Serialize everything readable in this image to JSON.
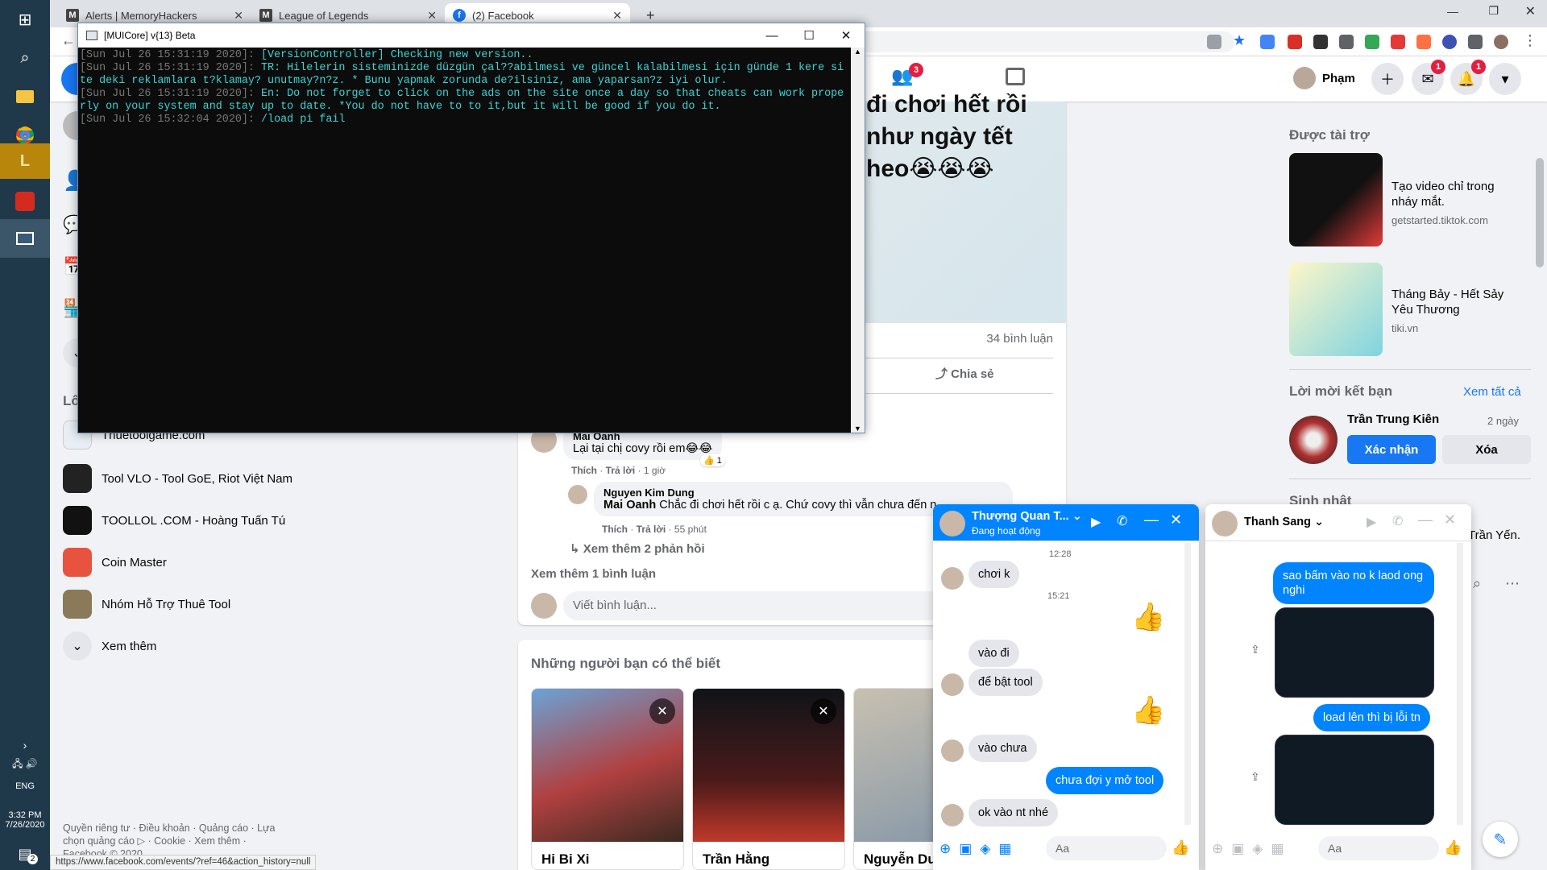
{
  "tabs": [
    {
      "label": "Alerts | MemoryHackers",
      "fav": "M"
    },
    {
      "label": "League of Legends",
      "fav": "M"
    },
    {
      "label": "(2) Facebook",
      "fav": "f"
    }
  ],
  "new_tab": "+",
  "taskbar": {
    "lang": "ENG",
    "time": "3:32 PM",
    "date": "7/26/2020",
    "notif_count": "2"
  },
  "header": {
    "user": "Phạm",
    "groups_badge": "3",
    "messenger_badge": "1",
    "notif_badge": "1"
  },
  "console": {
    "title": "[MUICore] v{13} Beta",
    "lines": [
      {
        "ts": "[Sun Jul 26 15:31:19 2020]: ",
        "msg": "[VersionController] Checking new version.."
      },
      {
        "ts": "[Sun Jul 26 15:31:19 2020]: ",
        "msg": "TR: Hilelerin sisteminizde düzgün çal??abilmesi ve güncel kalabilmesi için günde 1 kere site deki reklamlara t?klamay? unutmay?n?z. * Bunu yapmak zorunda de?ilsiniz, ama yaparsan?z iyi olur."
      },
      {
        "ts": "[Sun Jul 26 15:31:19 2020]: ",
        "msg": "En: Do not forget to click on the ads on the site once a day so that cheats can work properly on your system and stay up to date. *You do not have to to it,but it will be good if you do it."
      },
      {
        "ts": "[Sun Jul 26 15:32:04 2020]: ",
        "msg": "/load pi fail"
      }
    ]
  },
  "post": {
    "text_lines": [
      "đi chơi hết rồi",
      "như ngày tết",
      "heo😭😭😭"
    ],
    "comments_count": "34 bình luận",
    "share": "Chia sẻ",
    "comment1": {
      "name": "Mai Oanh",
      "text": "Lại tại chị covy rồi em😂😂",
      "like": "Thích",
      "reply": "Trả lời",
      "time": "1 giờ",
      "reactions": "1"
    },
    "comment2": {
      "name": "Nguyen Kim Dung",
      "mention": "Mai Oanh",
      "text": " Chắc đi chơi hết rồi c ạ. Chứ covy thì vẫn chưa đến n",
      "like": "Thích",
      "reply": "Trả lời",
      "time": "55 phút"
    },
    "more_replies": "Xem thêm 2 phản hồi",
    "more_comments": "Xem thêm 1 bình luận",
    "write_placeholder": "Viết bình luận..."
  },
  "pymk": {
    "title": "Những người bạn có thể biết",
    "people": [
      "Hi Bi Xi",
      "Trần Hằng",
      "Nguyễn Du"
    ]
  },
  "leftnav": {
    "section_label": "Lố",
    "items": [
      "Thuetoolgame.com",
      "Tool VLO - Tool GoE, Riot Việt Nam",
      "TOOLLOL .COM - Hoàng Tuấn Tú",
      "Coin Master",
      "Nhóm Hỗ Trợ Thuê Tool"
    ],
    "see_more": "Xem thêm",
    "footer1": "Quyền riêng tư · Điều khoản · Quảng cáo · Lựa",
    "footer2": "chọn quảng cáo ▷ · Cookie · Xem thêm ·",
    "footer3": "Facebook © 2020"
  },
  "right": {
    "sponsored": "Được tài trợ",
    "ads": [
      {
        "title": "Tạo video chỉ trong nháy mắt.",
        "domain": "getstarted.tiktok.com"
      },
      {
        "title": "Tháng Bảy - Hết Sảy Yêu Thương",
        "domain": "tiki.vn"
      }
    ],
    "friend_req_title": "Lời mời kết bạn",
    "see_all": "Xem tất cả",
    "req_name": "Trần Trung Kiên",
    "req_time": "2 ngày",
    "confirm": "Xác nhận",
    "delete": "Xóa",
    "birthday": "Sinh nhật",
    "birthday_name": "Trần Yến."
  },
  "chat1": {
    "name": "Thượng Quan T...",
    "status": "Đang hoạt động",
    "ts1": "12:28",
    "ts2": "15:21",
    "msgs": [
      "chơi k",
      "vào đi",
      "để bật tool",
      "vào chưa",
      "chưa đợi y mở tool",
      "ok vào nt nhé"
    ],
    "input": "Aa"
  },
  "chat2": {
    "name": "Thanh Sang",
    "msgs": [
      "sao bấm vào no k laod ong nghi",
      "load lên thì bị lỗi tn"
    ],
    "input": "Aa"
  },
  "status_url": "https://www.facebook.com/events/?ref=46&action_history=null"
}
